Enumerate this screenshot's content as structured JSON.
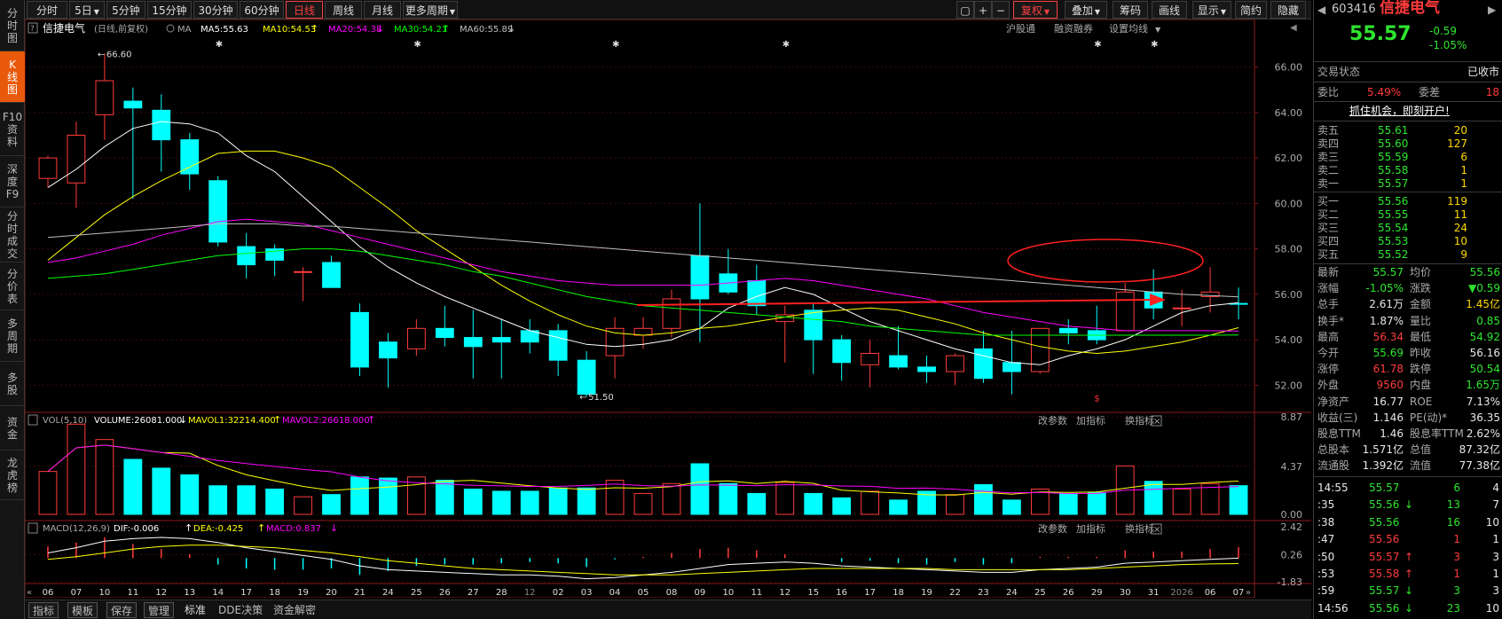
{
  "toolbar": {
    "periods": [
      "分时",
      "5日",
      "5分钟",
      "15分钟",
      "30分钟",
      "60分钟",
      "日线",
      "周线",
      "月线",
      "更多周期"
    ],
    "active_period": "日线",
    "right_buttons": [
      "复权",
      "叠加",
      "筹码",
      "画线",
      "显示",
      "简约",
      "隐藏"
    ]
  },
  "left_sidebar": {
    "items": [
      [
        "分",
        "时",
        "图"
      ],
      [
        "K",
        "线",
        "图"
      ],
      [
        "F10",
        "资",
        "料"
      ],
      [
        "深",
        "度",
        "F9"
      ],
      [
        "分",
        "时",
        "成",
        "交"
      ],
      [
        "分",
        "价",
        "表"
      ],
      [
        "多",
        "周",
        "期"
      ],
      [
        "多",
        "股"
      ],
      [
        "资",
        "金"
      ],
      [
        "龙",
        "虎",
        "榜"
      ]
    ],
    "active_index": 1
  },
  "chart": {
    "main_legend": {
      "name": "信捷电气",
      "cycle": "(日线,前复权)",
      "ma_label": "MA",
      "ma5": "MA5:55.63",
      "ma10": "MA10:54.53",
      "ma20": "MA20:54.38",
      "ma30": "MA30:54.21",
      "ma60": "MA60:55.89"
    },
    "main_buttons": [
      "沪股通",
      "融资融券",
      "设置均线"
    ],
    "vol_legend": {
      "label": "VOL(5,10)",
      "volume": "VOLUME:26081.000",
      "mavol1": "MAVOL1:32214.400",
      "mavol2": "MAVOL2:26618.000"
    },
    "macd_legend": {
      "label": "MACD(12,26,9)",
      "dif": "DIF:-0.006",
      "dea": "DEA:-0.425",
      "macd": "MACD:0.837"
    },
    "sub_buttons": [
      "改参数",
      "加指标",
      "换指标"
    ],
    "main_y_ticks": [
      "66.00",
      "64.00",
      "62.00",
      "60.00",
      "58.00",
      "56.00",
      "54.00",
      "52.00"
    ],
    "vol_y_ticks": [
      "8.87",
      "4.37",
      "0.00"
    ],
    "macd_y_ticks": [
      "2.42",
      "0.26",
      "-1.83"
    ],
    "high_label": "66.60",
    "low_label": "51.50",
    "x_labels": [
      "06",
      "07",
      "10",
      "11",
      "12",
      "13",
      "14",
      "17",
      "18",
      "19",
      "20",
      "21",
      "24",
      "25",
      "26",
      "27",
      "28",
      "12",
      "02",
      "03",
      "04",
      "05",
      "08",
      "09",
      "10",
      "11",
      "12",
      "15",
      "16",
      "17",
      "18",
      "19",
      "22",
      "23",
      "24",
      "25",
      "26",
      "29",
      "30",
      "31",
      "2026",
      "06",
      "07"
    ]
  },
  "chart_data": {
    "type": "candlestick",
    "dates": [
      "06",
      "07",
      "10",
      "11",
      "12",
      "13",
      "14",
      "17",
      "18",
      "19",
      "20",
      "21",
      "24",
      "25",
      "26",
      "27",
      "28",
      "12-01",
      "02",
      "03",
      "04",
      "05",
      "08",
      "09",
      "10",
      "11",
      "12",
      "15",
      "16",
      "17",
      "18",
      "19",
      "22",
      "23",
      "24",
      "25",
      "26",
      "29",
      "30",
      "31",
      "2026-01-05",
      "06",
      "07"
    ],
    "open": [
      61.1,
      60.9,
      63.9,
      64.5,
      64.1,
      62.8,
      61.0,
      58.1,
      58.0,
      57.0,
      57.4,
      55.2,
      53.9,
      53.6,
      54.5,
      54.1,
      54.1,
      54.4,
      54.4,
      53.1,
      53.3,
      54.2,
      54.5,
      57.7,
      56.9,
      56.6,
      54.8,
      55.3,
      54.0,
      52.9,
      53.3,
      52.8,
      52.6,
      53.6,
      53.0,
      52.6,
      54.5,
      54.4,
      54.4,
      56.1,
      55.4,
      55.9,
      55.6
    ],
    "high": [
      62.1,
      63.6,
      66.6,
      65.1,
      64.8,
      63.1,
      61.2,
      58.7,
      58.2,
      57.2,
      57.7,
      55.6,
      54.3,
      54.9,
      55.5,
      55.3,
      54.9,
      54.9,
      54.7,
      53.5,
      55.0,
      55.0,
      56.2,
      60.0,
      58.0,
      57.3,
      55.5,
      55.6,
      54.2,
      54.0,
      54.6,
      53.3,
      53.4,
      54.4,
      54.4,
      54.1,
      54.9,
      55.5,
      56.5,
      57.1,
      56.2,
      57.2,
      56.3
    ],
    "low": [
      60.7,
      59.8,
      62.8,
      60.2,
      61.4,
      60.6,
      58.1,
      56.7,
      56.8,
      55.7,
      56.4,
      52.4,
      51.9,
      53.3,
      53.7,
      52.3,
      52.3,
      53.4,
      52.4,
      51.5,
      52.3,
      53.6,
      54.1,
      53.9,
      56.0,
      55.1,
      53.0,
      52.5,
      52.2,
      51.9,
      52.7,
      52.1,
      52.0,
      52.1,
      51.6,
      52.5,
      53.8,
      53.8,
      54.6,
      54.9,
      54.6,
      55.2,
      54.9
    ],
    "close": [
      62.0,
      63.0,
      65.4,
      64.2,
      62.8,
      61.3,
      58.3,
      57.3,
      57.5,
      57.0,
      56.3,
      52.8,
      53.2,
      54.5,
      54.1,
      53.7,
      53.9,
      53.9,
      53.1,
      51.6,
      54.5,
      54.5,
      55.8,
      55.8,
      56.1,
      55.5,
      55.1,
      54.0,
      53.0,
      53.4,
      52.8,
      52.6,
      53.3,
      52.3,
      52.6,
      54.5,
      54.3,
      54.0,
      56.1,
      55.4,
      55.4,
      56.1,
      55.57
    ],
    "ma_series": [
      {
        "name": "MA5",
        "values": [
          60.7,
          61.5,
          62.5,
          63.3,
          63.6,
          63.5,
          63.1,
          62.1,
          61.4,
          60.3,
          59.2,
          58.1,
          57.2,
          56.5,
          55.9,
          55.4,
          54.9,
          54.4,
          54.1,
          53.8,
          53.7,
          53.8,
          54.0,
          54.5,
          55.4,
          55.9,
          56.3,
          56.0,
          55.4,
          54.8,
          54.4,
          54.0,
          53.6,
          53.3,
          53.0,
          52.9,
          53.3,
          53.6,
          54.0,
          54.6,
          55.2,
          55.5,
          55.63
        ]
      },
      {
        "name": "MA10",
        "values": [
          57.5,
          58.5,
          59.5,
          60.3,
          61.0,
          61.6,
          62.2,
          62.3,
          62.3,
          62.0,
          61.6,
          60.7,
          59.8,
          58.8,
          58.0,
          57.2,
          56.4,
          55.7,
          55.1,
          54.6,
          54.3,
          54.2,
          54.3,
          54.5,
          54.6,
          54.8,
          55.0,
          55.2,
          55.3,
          55.4,
          55.3,
          55.0,
          54.7,
          54.3,
          54.0,
          53.7,
          53.5,
          53.4,
          53.5,
          53.7,
          53.9,
          54.2,
          54.53
        ]
      },
      {
        "name": "MA20",
        "values": [
          57.4,
          57.6,
          57.9,
          58.2,
          58.6,
          58.9,
          59.2,
          59.3,
          59.2,
          59.1,
          58.8,
          58.5,
          58.2,
          57.9,
          57.6,
          57.3,
          57.0,
          56.8,
          56.6,
          56.5,
          56.4,
          56.4,
          56.4,
          56.4,
          56.5,
          56.6,
          56.7,
          56.6,
          56.4,
          56.2,
          56.0,
          55.8,
          55.5,
          55.2,
          55.0,
          54.8,
          54.6,
          54.5,
          54.4,
          54.4,
          54.4,
          54.4,
          54.38
        ]
      },
      {
        "name": "MA30",
        "values": [
          56.7,
          56.8,
          56.9,
          57.1,
          57.3,
          57.5,
          57.7,
          57.8,
          57.9,
          58.0,
          58.0,
          57.9,
          57.7,
          57.5,
          57.3,
          57.0,
          56.8,
          56.5,
          56.2,
          55.9,
          55.7,
          55.5,
          55.4,
          55.3,
          55.2,
          55.1,
          55.0,
          54.9,
          54.8,
          54.6,
          54.5,
          54.4,
          54.3,
          54.2,
          54.2,
          54.2,
          54.2,
          54.2,
          54.2,
          54.2,
          54.2,
          54.2,
          54.21
        ]
      },
      {
        "name": "MA60",
        "values": [
          58.5,
          58.6,
          58.7,
          58.8,
          58.9,
          59.0,
          59.1,
          59.1,
          59.1,
          59.0,
          59.0,
          58.9,
          58.8,
          58.7,
          58.6,
          58.5,
          58.4,
          58.3,
          58.2,
          58.1,
          58.0,
          57.9,
          57.8,
          57.7,
          57.6,
          57.5,
          57.4,
          57.3,
          57.2,
          57.1,
          57.0,
          56.9,
          56.8,
          56.7,
          56.6,
          56.5,
          56.4,
          56.3,
          56.2,
          56.1,
          56.0,
          55.95,
          55.89
        ]
      }
    ],
    "volume": [
      3.9,
      8.2,
      6.8,
      5.0,
      4.2,
      3.6,
      2.6,
      2.6,
      2.3,
      1.6,
      1.8,
      3.4,
      3.3,
      3.4,
      3.1,
      2.3,
      2.1,
      2.1,
      2.4,
      2.4,
      3.1,
      1.9,
      2.8,
      4.6,
      2.8,
      1.9,
      2.9,
      1.9,
      1.5,
      2.1,
      1.3,
      2.1,
      1.8,
      2.7,
      1.3,
      2.3,
      1.9,
      2.0,
      4.4,
      3.0,
      2.3,
      2.8,
      2.61
    ],
    "macd_hist": [
      0.9,
      1.2,
      1.6,
      1.1,
      0.7,
      0.3,
      -0.5,
      -0.8,
      -0.9,
      -0.9,
      -0.8,
      -1.3,
      -1.0,
      -0.6,
      -0.5,
      -0.5,
      -0.4,
      -0.3,
      -0.4,
      -0.7,
      -0.1,
      0.1,
      0.4,
      0.7,
      0.8,
      0.6,
      0.3,
      0.0,
      -0.3,
      -0.2,
      -0.4,
      -0.5,
      -0.3,
      -0.5,
      -0.4,
      0.1,
      0.1,
      0.1,
      0.6,
      0.5,
      0.5,
      0.7,
      0.84
    ],
    "dif": [
      0.4,
      0.8,
      1.3,
      1.5,
      1.6,
      1.5,
      1.2,
      0.8,
      0.5,
      0.2,
      -0.1,
      -0.6,
      -0.9,
      -1.0,
      -1.1,
      -1.2,
      -1.3,
      -1.3,
      -1.4,
      -1.6,
      -1.5,
      -1.3,
      -1.1,
      -0.8,
      -0.5,
      -0.4,
      -0.3,
      -0.4,
      -0.6,
      -0.7,
      -0.8,
      -0.9,
      -1.0,
      -1.1,
      -1.1,
      -0.9,
      -0.8,
      -0.7,
      -0.4,
      -0.3,
      -0.2,
      -0.1,
      -0.006
    ],
    "dea": [
      -0.1,
      0.1,
      0.4,
      0.7,
      0.9,
      1.0,
      1.0,
      0.9,
      0.8,
      0.6,
      0.4,
      0.1,
      -0.2,
      -0.4,
      -0.6,
      -0.8,
      -0.9,
      -1.0,
      -1.1,
      -1.2,
      -1.3,
      -1.3,
      -1.3,
      -1.2,
      -1.1,
      -1.0,
      -0.9,
      -0.8,
      -0.8,
      -0.8,
      -0.8,
      -0.8,
      -0.9,
      -0.9,
      -0.9,
      -0.9,
      -0.9,
      -0.8,
      -0.7,
      -0.6,
      -0.5,
      -0.45,
      -0.425
    ],
    "main_ylim": [
      51.0,
      67.0
    ],
    "vol_ylim": [
      0,
      8.87
    ],
    "macd_ylim": [
      -1.83,
      2.42
    ]
  },
  "quote": {
    "code": "603416",
    "name": "信捷电气",
    "price": "55.57",
    "change": "-0.59",
    "change_pct": "-1.05%",
    "trade_status_label": "交易状态",
    "trade_status": "已收市",
    "weibi_label": "委比",
    "weibi": "5.49%",
    "weicha_label": "委差",
    "weicha": "18",
    "promo": "抓住机会，即刻开户!",
    "sells": [
      {
        "label": "卖五",
        "price": "55.61",
        "vol": "20"
      },
      {
        "label": "卖四",
        "price": "55.60",
        "vol": "127"
      },
      {
        "label": "卖三",
        "price": "55.59",
        "vol": "6"
      },
      {
        "label": "卖二",
        "price": "55.58",
        "vol": "1"
      },
      {
        "label": "卖一",
        "price": "55.57",
        "vol": "1"
      }
    ],
    "buys": [
      {
        "label": "买一",
        "price": "55.56",
        "vol": "119"
      },
      {
        "label": "买二",
        "price": "55.55",
        "vol": "11"
      },
      {
        "label": "买三",
        "price": "55.54",
        "vol": "24"
      },
      {
        "label": "买四",
        "price": "55.53",
        "vol": "10"
      },
      {
        "label": "买五",
        "price": "55.52",
        "vol": "9"
      }
    ],
    "stats": [
      {
        "l1": "最新",
        "v1": "55.57",
        "c1": "grn",
        "l2": "均价",
        "v2": "55.56",
        "c2": "grn"
      },
      {
        "l1": "涨幅",
        "v1": "-1.05%",
        "c1": "grn",
        "l2": "涨跌",
        "v2": "▼0.59",
        "c2": "grn"
      },
      {
        "l1": "总手",
        "v1": "2.61万",
        "c1": "wht",
        "l2": "金额",
        "v2": "1.45亿",
        "c2": "yel"
      },
      {
        "l1": "换手*",
        "v1": "1.87%",
        "c1": "wht",
        "l2": "量比",
        "v2": "0.85",
        "c2": "grn"
      },
      {
        "l1": "最高",
        "v1": "56.34",
        "c1": "red",
        "l2": "最低",
        "v2": "54.92",
        "c2": "grn"
      },
      {
        "l1": "今开",
        "v1": "55.69",
        "c1": "grn",
        "l2": "昨收",
        "v2": "56.16",
        "c2": "wht"
      },
      {
        "l1": "涨停",
        "v1": "61.78",
        "c1": "red",
        "l2": "跌停",
        "v2": "50.54",
        "c2": "grn"
      },
      {
        "l1": "外盘",
        "v1": "9560",
        "c1": "red",
        "l2": "内盘",
        "v2": "1.65万",
        "c2": "grn"
      },
      {
        "l1": "净资产",
        "v1": "16.77",
        "c1": "wht",
        "l2": "ROE",
        "v2": "7.13%",
        "c2": "wht"
      },
      {
        "l1": "收益(三)",
        "v1": "1.146",
        "c1": "wht",
        "l2": "PE(动)*",
        "v2": "36.35",
        "c2": "wht"
      },
      {
        "l1": "股息TTM",
        "v1": "1.46",
        "c1": "wht",
        "l2": "股息率TTM",
        "v2": "2.62%",
        "c2": "wht"
      },
      {
        "l1": "总股本",
        "v1": "1.571亿",
        "c1": "wht",
        "l2": "总值",
        "v2": "87.32亿",
        "c2": "wht"
      },
      {
        "l1": "流通股",
        "v1": "1.392亿",
        "c1": "wht",
        "l2": "流值",
        "v2": "77.38亿",
        "c2": "wht"
      }
    ],
    "ticks": [
      {
        "time": "14:55",
        "price": "55.57",
        "arrow": "",
        "vol": "6",
        "n": "4",
        "c": "grn"
      },
      {
        "time": ":35",
        "price": "55.56",
        "arrow": "↓",
        "vol": "13",
        "n": "7",
        "c": "grn"
      },
      {
        "time": ":38",
        "price": "55.56",
        "arrow": "",
        "vol": "16",
        "n": "10",
        "c": "grn"
      },
      {
        "time": ":47",
        "price": "55.56",
        "arrow": "",
        "vol": "1",
        "n": "1",
        "c": "red"
      },
      {
        "time": ":50",
        "price": "55.57",
        "arrow": "↑",
        "vol": "3",
        "n": "3",
        "c": "red"
      },
      {
        "time": ":53",
        "price": "55.58",
        "arrow": "↑",
        "vol": "1",
        "n": "1",
        "c": "red"
      },
      {
        "time": ":59",
        "price": "55.57",
        "arrow": "↓",
        "vol": "3",
        "n": "3",
        "c": "grn"
      },
      {
        "time": "14:56",
        "price": "55.56",
        "arrow": "↓",
        "vol": "23",
        "n": "10",
        "c": "grn"
      }
    ]
  },
  "bottom_tabs": [
    "指标",
    "模板",
    "保存",
    "管理",
    "标准",
    "DDE决策",
    "资金解密"
  ],
  "colors": {
    "up": "#ff3b3b",
    "down": "#00ffff",
    "ma5": "#ffffff",
    "ma10": "#ffff00",
    "ma20": "#ff00ff",
    "ma30": "#00ff00",
    "ma60": "#bfbfbf",
    "accent": "#e8590c",
    "annotation": "#ff2020"
  }
}
